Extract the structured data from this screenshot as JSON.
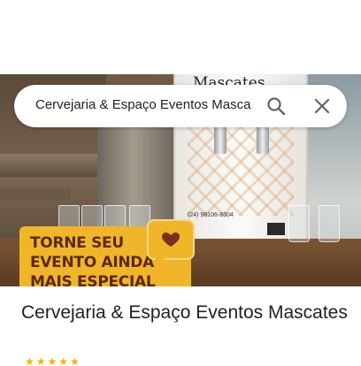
{
  "search": {
    "value": "Cervejaria & Espaço Eventos Masca",
    "search_icon": "search-icon",
    "close_icon": "close-icon"
  },
  "hero": {
    "sign_text": "Mascates",
    "phone_text": "(24) 98106-8304",
    "promo": {
      "line1": "TORNE SEU",
      "line2": "EVENTO AINDA",
      "line3": "MAIS ESPECIAL",
      "icon": "heart-icon"
    }
  },
  "place": {
    "title": "Cervejaria & Espaço Eventos Mascates"
  },
  "colors": {
    "promo_yellow": "#f1b52a",
    "promo_text": "#5b2a16",
    "heart": "#7a2f1d",
    "star": "#f4b400"
  }
}
